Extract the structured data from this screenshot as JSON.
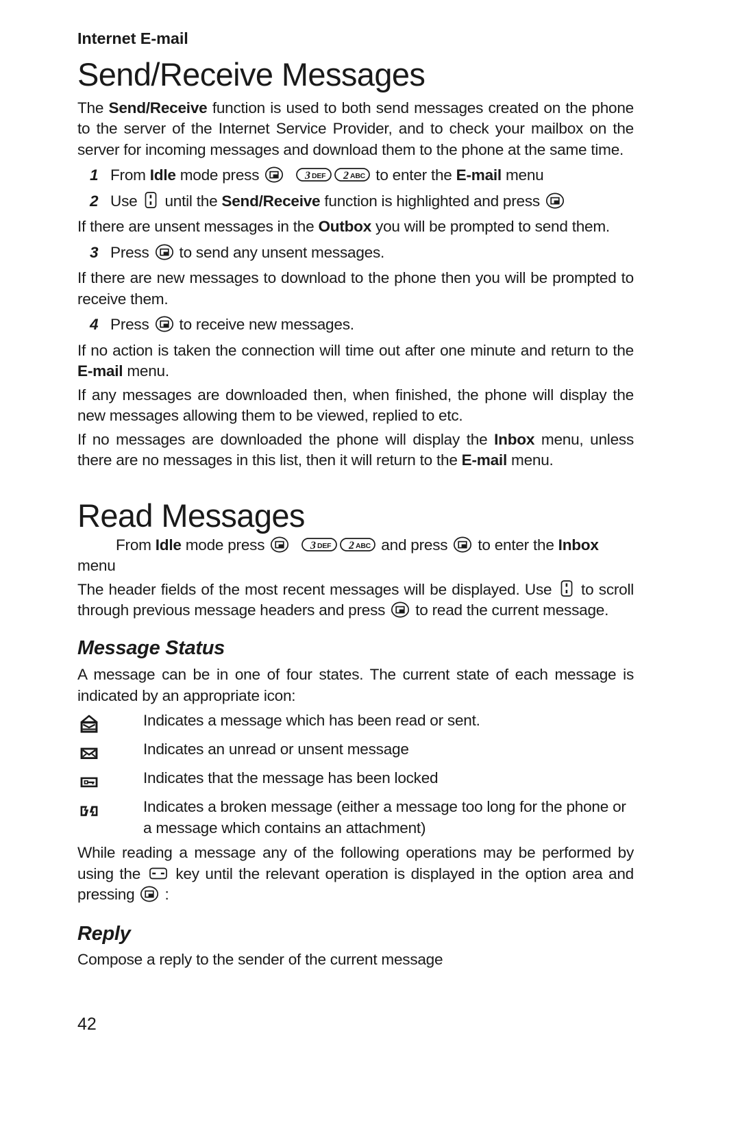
{
  "page": {
    "running_head": "Internet E-mail",
    "folio": "42"
  },
  "section_send_receive": {
    "title": "Send/Receive Messages",
    "intro": {
      "pre": "The ",
      "bold": "Send/Receive",
      "post": " function is used to both send messages created on the phone to the server of the Internet Service Provider, and to check your mailbox on the server for incoming messages and download them to the phone at the same time."
    },
    "steps": [
      {
        "num": "1",
        "p1": "From ",
        "b1": "Idle",
        "p2": " mode press ",
        "icon1": "select-key-icon",
        "icon2": "key-3-def-icon",
        "icon3": "key-2-abc-icon",
        "p3": " to enter the ",
        "b2": "E-mail",
        "p4": " menu"
      },
      {
        "num": "2",
        "p1": "Use ",
        "icon1": "updown-key-icon",
        "p2": " until the ",
        "b1": "Send/Receive",
        "p3": " function is highlighted and press ",
        "icon2": "select-key-icon",
        "p4": ""
      },
      {
        "num": "3",
        "p1": "Press ",
        "icon1": "select-key-icon",
        "p2": " to send any unsent messages."
      },
      {
        "num": "4",
        "p1": "Press ",
        "icon1": "select-key-icon",
        "p2": " to receive new messages."
      }
    ],
    "para_outbox": {
      "pre": "If there are unsent messages in the ",
      "bold": "Outbox",
      "post": " you will be prompted to send them."
    },
    "para_new_messages": "If there are new messages to download to the phone then you will be prompted to receive them.",
    "para_timeout": {
      "pre": "If no action is taken the connection will time out after one minute and return to the ",
      "bold": "E-mail",
      "post": " menu."
    },
    "para_downloaded": "If any messages are downloaded then, when finished, the phone will display the new messages allowing them to be viewed, replied to etc.",
    "para_no_messages": {
      "pre": "If no messages are downloaded the phone will display the ",
      "bold1": "Inbox",
      "mid": " menu, unless there are no messages in this list, then it will return to the ",
      "bold2": "E-mail",
      "post": " menu."
    }
  },
  "section_read_messages": {
    "title": "Read Messages",
    "intro_step": {
      "p1": "From ",
      "b1": "Idle",
      "p2": " mode press ",
      "icon1": "select-key-icon",
      "icon2": "key-3-def-icon",
      "icon3": "key-2-abc-icon",
      "p3": " and press ",
      "icon4": "select-key-icon",
      "p4": " to enter the ",
      "b2": "Inbox",
      "p5": " menu"
    },
    "para_header_fields": {
      "p1": "The header fields of the most recent messages will be displayed. Use ",
      "icon1": "updown-key-icon",
      "p2": " to scroll through previous message headers and press ",
      "icon2": "select-key-icon",
      "p3": " to read the current message."
    },
    "message_status": {
      "title": "Message Status",
      "intro": "A message can be in one of four states. The current state of each message is indicated by an appropriate icon:",
      "items": [
        {
          "icon": "open-envelope-icon",
          "text": "Indicates a message which has been read or sent."
        },
        {
          "icon": "closed-envelope-icon",
          "text": "Indicates an unread or unsent message"
        },
        {
          "icon": "locked-message-icon",
          "text": "Indicates that the message has been locked"
        },
        {
          "icon": "broken-message-icon",
          "text": "Indicates a broken message (either a message too long for the phone or a message which contains an attachment)"
        }
      ]
    },
    "para_operations": {
      "p1": "While reading a message any of the following operations may be performed by using the ",
      "icon1": "leftright-key-icon",
      "p2": " key until the relevant operation is displayed in the option area and pressing ",
      "icon2": "select-key-icon",
      "p3": " :"
    },
    "reply": {
      "title": "Reply",
      "text": "Compose a reply to the sender of the current message"
    }
  },
  "keypad_labels": {
    "key3_digit": "3",
    "key3_letters": "DEF",
    "key2_digit": "2",
    "key2_letters": "ABC"
  },
  "colors": {
    "ink": "#1a1a1a",
    "paper": "#ffffff"
  }
}
